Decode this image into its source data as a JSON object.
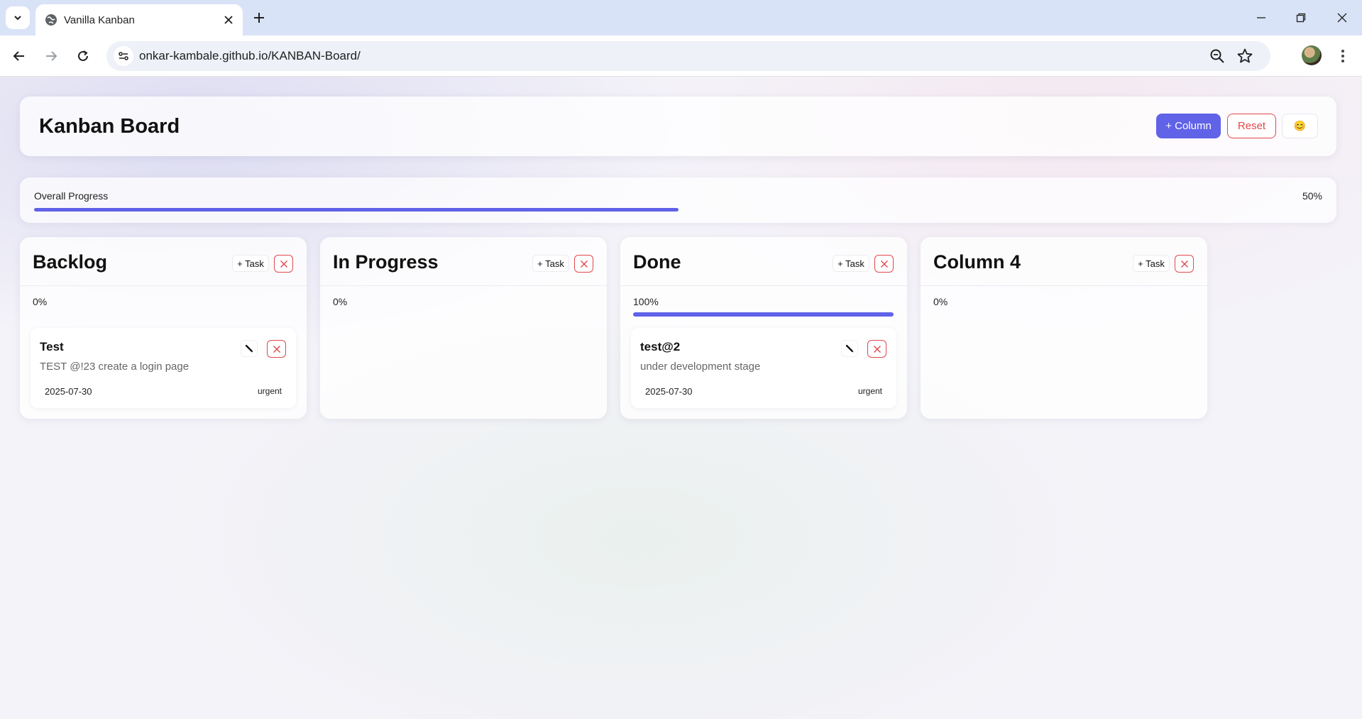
{
  "browser": {
    "tab_title": "Vanilla Kanban",
    "url": "onkar-kambale.github.io/KANBAN-Board/"
  },
  "header": {
    "title": "Kanban Board",
    "add_column_label": "+ Column",
    "reset_label": "Reset",
    "theme_icon": "emoji-face-icon",
    "theme_glyph": "😊"
  },
  "overall": {
    "label": "Overall Progress",
    "percent_text": "50%",
    "percent": 50
  },
  "colors": {
    "accent": "#6062e8",
    "danger": "#e0474c"
  },
  "columns": [
    {
      "title": "Backlog",
      "add_task_label": "+ Task",
      "percent_text": "0%",
      "percent": 0,
      "tasks": [
        {
          "title": "Test",
          "description": "TEST @!23 create a login page",
          "date": "2025-07-30",
          "priority": "urgent"
        }
      ]
    },
    {
      "title": "In Progress",
      "add_task_label": "+ Task",
      "percent_text": "0%",
      "percent": 0,
      "tasks": []
    },
    {
      "title": "Done",
      "add_task_label": "+ Task",
      "percent_text": "100%",
      "percent": 100,
      "tasks": [
        {
          "title": "test@2",
          "description": "under development stage",
          "date": "2025-07-30",
          "priority": "urgent"
        }
      ]
    },
    {
      "title": "Column 4",
      "add_task_label": "+ Task",
      "percent_text": "0%",
      "percent": 0,
      "tasks": []
    }
  ]
}
